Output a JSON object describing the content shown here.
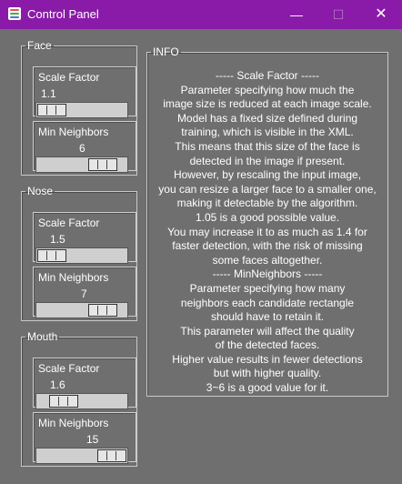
{
  "window": {
    "title": "Control Panel",
    "minimize_glyph": "—",
    "maximize_glyph": "☐",
    "close_glyph": "✕"
  },
  "groups": [
    {
      "label": "Face",
      "sliders": [
        {
          "label": "Scale Factor",
          "value": "1.1",
          "level": 0.0
        },
        {
          "label": "Min Neighbors",
          "value": "6",
          "level": 0.85
        }
      ]
    },
    {
      "label": "Nose",
      "sliders": [
        {
          "label": "Scale Factor",
          "value": "1.5",
          "level": 0.0
        },
        {
          "label": "Min Neighbors",
          "value": "7",
          "level": 0.85
        }
      ]
    },
    {
      "label": "Mouth",
      "sliders": [
        {
          "label": "Scale Factor",
          "value": "1.6",
          "level": 0.2
        },
        {
          "label": "Min Neighbors",
          "value": "15",
          "level": 1.0
        }
      ]
    }
  ],
  "info": {
    "label": "INFO",
    "lines": [
      "----- Scale Factor -----",
      "Parameter specifying how much the",
      "image size is reduced at each image scale.",
      "Model has a fixed size defined during",
      "training, which is visible in the XML.",
      "This means that this size of the face is",
      "detected in the image if present.",
      "However, by rescaling the input image,",
      "you can resize a larger face to a smaller one,",
      "making it detectable by the algorithm.",
      "1.05 is a good possible value.",
      "You may increase it to as much as 1.4 for",
      "faster detection, with the risk of missing",
      "some faces altogether.",
      "----- MinNeighbors -----",
      "Parameter specifying how many",
      "neighbors each candidate rectangle",
      "should have to retain it.",
      "This parameter will affect the quality",
      "of the detected faces.",
      "Higher value results in fewer detections",
      "but with higher quality.",
      "3~6 is a good value for it."
    ]
  },
  "colors": {
    "titlebar": "#8a1aa8",
    "background": "#6f6f6f",
    "track": "#cfcfcf"
  }
}
